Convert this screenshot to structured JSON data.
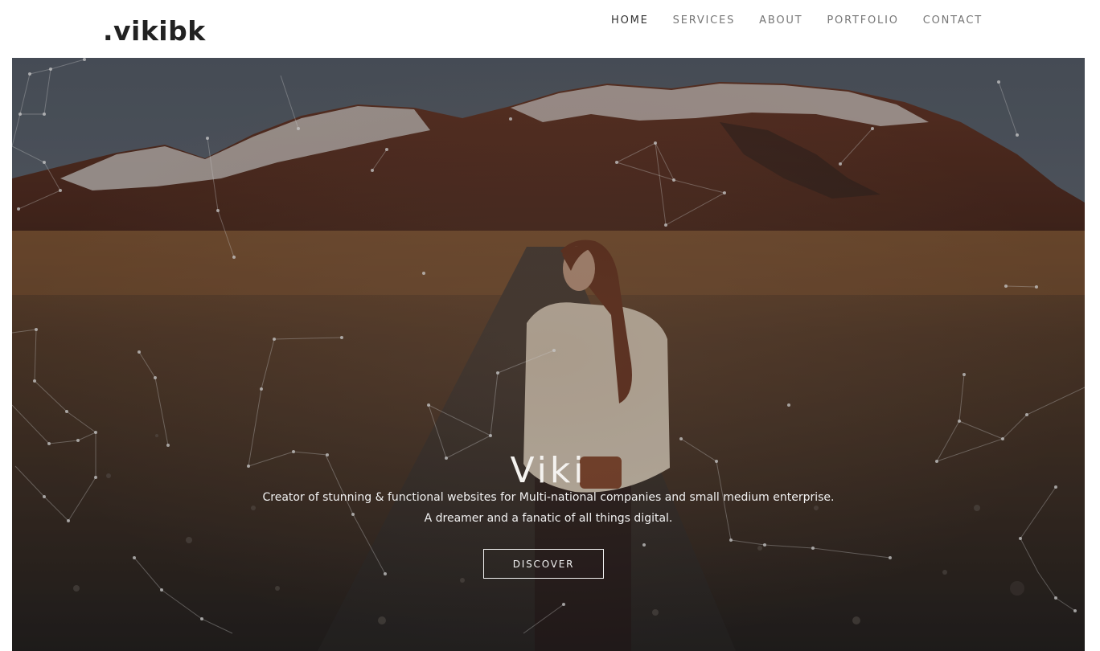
{
  "header": {
    "logo": ".vikibk",
    "nav": [
      {
        "label": "HOME",
        "active": true
      },
      {
        "label": "SERVICES",
        "active": false
      },
      {
        "label": "ABOUT",
        "active": false
      },
      {
        "label": "PORTFOLIO",
        "active": false
      },
      {
        "label": "CONTACT",
        "active": false
      }
    ]
  },
  "hero": {
    "title": "Viki",
    "tagline_line1": "Creator of stunning & functional websites for Multi-national companies and small medium enterprise.",
    "tagline_line2": "A dreamer and a fanatic of all things digital.",
    "cta_label": "DISCOVER"
  },
  "colors": {
    "accent_text": "#f1f1f1",
    "logo": "#222222",
    "nav_active": "#333333",
    "nav_inactive": "#777777"
  }
}
